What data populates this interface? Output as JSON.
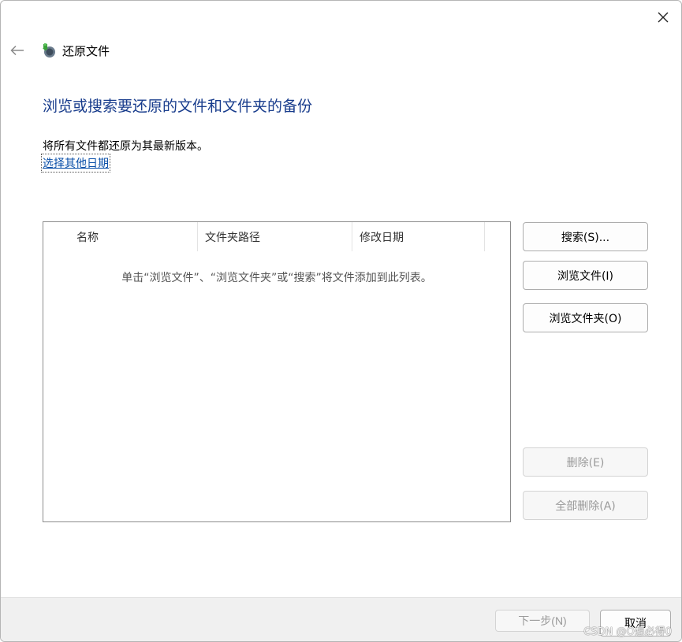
{
  "window": {
    "title": "还原文件",
    "heading": "浏览或搜索要还原的文件和文件夹的备份",
    "description": "将所有文件都还原为其最新版本。",
    "choose_date_link": "选择其他日期"
  },
  "list": {
    "columns": [
      "名称",
      "文件夹路径",
      "修改日期"
    ],
    "empty_message": "单击“浏览文件”、“浏览文件夹”或“搜索”将文件添加到此列表。"
  },
  "buttons": {
    "search": "搜索(S)...",
    "browse_files": "浏览文件(I)",
    "browse_folders": "浏览文件夹(O)",
    "remove": "删除(E)",
    "remove_all": "全部删除(A)",
    "next": "下一步(N)",
    "cancel": "取消"
  },
  "icons": {
    "close": "close-icon",
    "back": "back-arrow-icon",
    "app": "restore-files-icon"
  },
  "watermark": "CSDN @O想必得0",
  "colors": {
    "heading": "#183c8c",
    "link": "#0a4fa8",
    "footer_bg": "#f0f0f0",
    "disabled_text": "#9a9a9a"
  }
}
